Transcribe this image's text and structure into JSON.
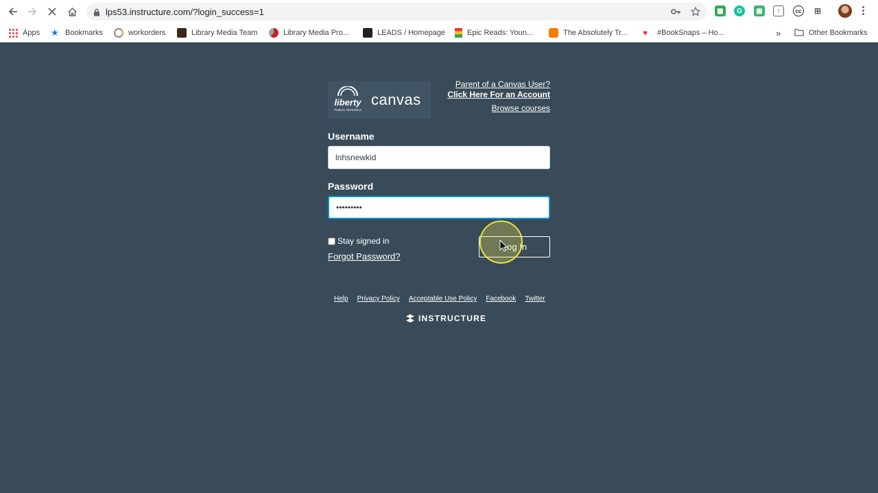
{
  "browser": {
    "url": "lps53.instructure.com/?login_success=1",
    "bookmarks": [
      {
        "label": "Apps"
      },
      {
        "label": "Bookmarks"
      },
      {
        "label": "workorders"
      },
      {
        "label": "Library Media Team"
      },
      {
        "label": "Library Media Pro..."
      },
      {
        "label": "LEADS / Homepage"
      },
      {
        "label": "Epic Reads: Youn..."
      },
      {
        "label": "The Absolutely Tr..."
      },
      {
        "label": "#BookSnaps – Ho..."
      }
    ],
    "overflow_label": "»",
    "other_bookmarks": "Other Bookmarks"
  },
  "login": {
    "logo_text": "canvas",
    "logo_school_text": "liberty",
    "logo_school_sub": "PUBLIC SCHOOLS",
    "parent_link": "Parent of a Canvas User?",
    "account_link": "Click Here For an Account",
    "browse_link": "Browse courses",
    "username_label": "Username",
    "username_value": "lnhsnewkid",
    "password_label": "Password",
    "password_value": "•••••••••",
    "stay_signed_in": "Stay signed in",
    "forgot_password": "Forgot Password?",
    "login_button": "Log In"
  },
  "footer": {
    "links": [
      "Help",
      "Privacy Policy",
      "Acceptable Use Policy",
      "Facebook",
      "Twitter"
    ],
    "brand": "INSTRUCTURE"
  },
  "colors": {
    "page_bg": "#394b58",
    "focus": "#0096d6",
    "cursor_highlight": "#ede43a"
  }
}
